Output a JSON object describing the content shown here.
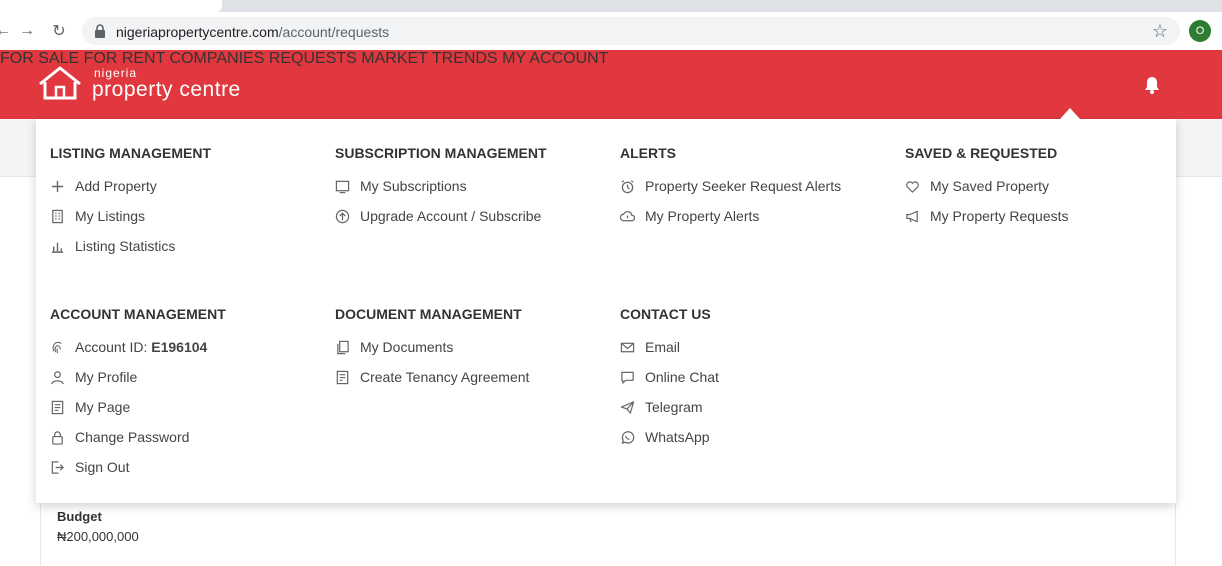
{
  "browser": {
    "url_domain": "nigeriapropertycentre.com",
    "url_path": "/account/requests",
    "profile_initial": "O"
  },
  "header": {
    "logo_top": "nigeria",
    "logo_bottom": "property centre",
    "nav": [
      "FOR SALE",
      "FOR RENT",
      "COMPANIES",
      "REQUESTS",
      "MARKET TRENDS",
      "MY ACCOUNT"
    ],
    "brand_color": "#e0383e"
  },
  "menu": {
    "listing_management": {
      "title": "LISTING MANAGEMENT",
      "items": [
        "Add Property",
        "My Listings",
        "Listing Statistics"
      ]
    },
    "account_management": {
      "title": "ACCOUNT MANAGEMENT",
      "account_id_label": "Account ID:",
      "account_id_value": "E196104",
      "items": [
        "My Profile",
        "My Page",
        "Change Password",
        "Sign Out"
      ]
    },
    "subscription_management": {
      "title": "SUBSCRIPTION MANAGEMENT",
      "items": [
        "My Subscriptions",
        "Upgrade Account / Subscribe"
      ]
    },
    "document_management": {
      "title": "DOCUMENT MANAGEMENT",
      "items": [
        "My Documents",
        "Create Tenancy Agreement"
      ]
    },
    "alerts": {
      "title": "ALERTS",
      "items": [
        "Property Seeker Request Alerts",
        "My Property Alerts"
      ]
    },
    "contact_us": {
      "title": "CONTACT US",
      "items": [
        "Email",
        "Online Chat",
        "Telegram",
        "WhatsApp"
      ]
    },
    "saved_requested": {
      "title": "SAVED & REQUESTED",
      "items": [
        "My Saved Property",
        "My Property Requests"
      ]
    }
  },
  "page": {
    "budget_label": "Budget",
    "budget_value": "₦200,000,000"
  }
}
